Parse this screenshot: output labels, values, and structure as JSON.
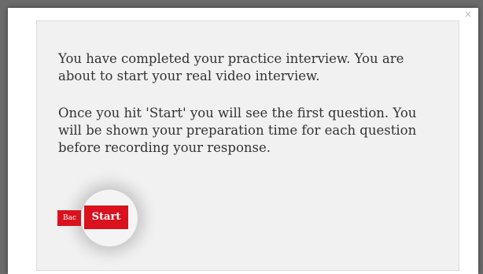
{
  "modal": {
    "close_symbol": "×",
    "paragraphs": [
      "You have completed your practice interview. You are about to start your real video interview.",
      "Once you hit 'Start' you will see the first question. You will be shown your preparation time for each question before recording your response."
    ],
    "back_label": "Bac",
    "start_label": "Start"
  },
  "colors": {
    "primary_button": "#d9121e",
    "panel_bg": "#f1f1f1",
    "backdrop": "#6b6b6b"
  }
}
